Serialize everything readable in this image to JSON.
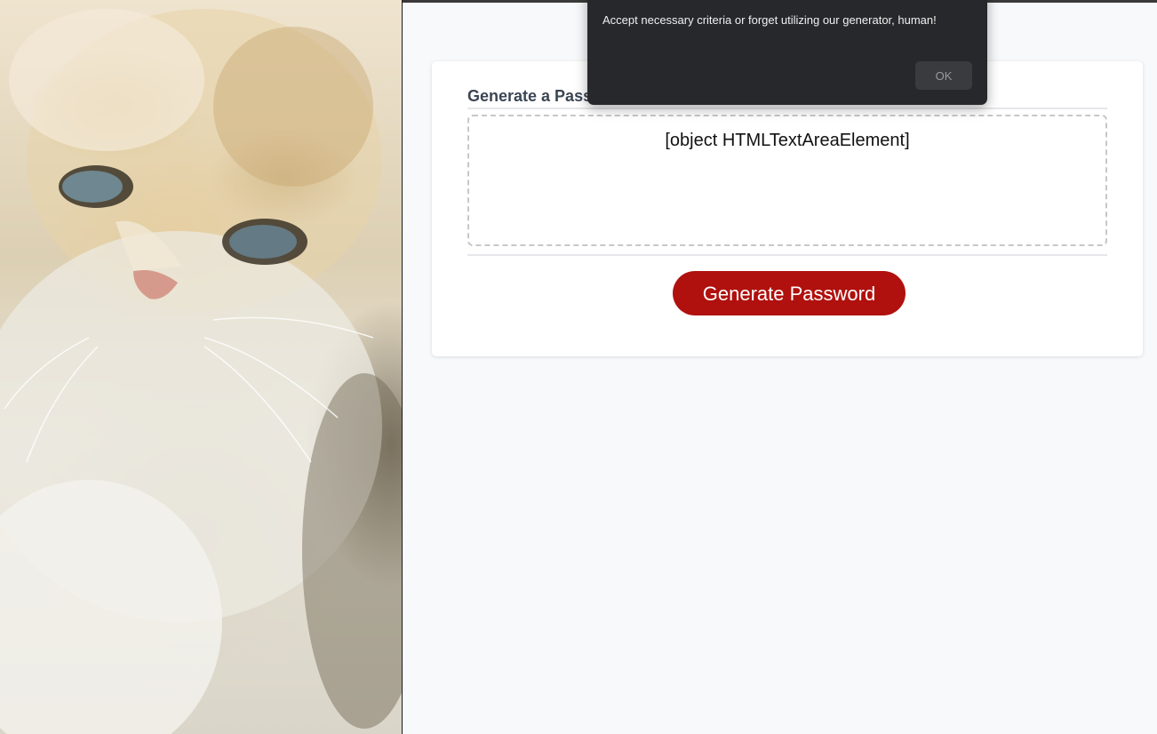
{
  "photo": {
    "subject": "fluffy cream-colored cat"
  },
  "generator": {
    "title": "Generate a Password",
    "password_output": "[object HTMLTextAreaElement]",
    "generate_button_label": "Generate Password"
  },
  "alert": {
    "heading": "",
    "message": "Accept necessary criteria or forget utilizing our generator, human!",
    "ok_label": "OK"
  },
  "colors": {
    "button": "#b0110e",
    "dialog_bg": "#27282c",
    "page_bg": "#f8f9fb"
  }
}
